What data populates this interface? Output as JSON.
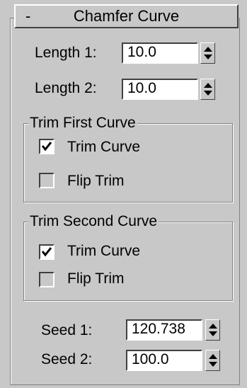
{
  "rollout": {
    "toggle_symbol": "-",
    "title": "Chamfer Curve"
  },
  "length1": {
    "label": "Length 1:",
    "value": "10.0"
  },
  "length2": {
    "label": "Length 2:",
    "value": "10.0"
  },
  "trim_first": {
    "title": "Trim First Curve",
    "trim_curve": {
      "label": "Trim Curve",
      "checked": true
    },
    "flip_trim": {
      "label": "Flip Trim",
      "checked": false
    }
  },
  "trim_second": {
    "title": "Trim Second Curve",
    "trim_curve": {
      "label": "Trim Curve",
      "checked": true
    },
    "flip_trim": {
      "label": "Flip Trim",
      "checked": false
    }
  },
  "seed1": {
    "label": "Seed 1:",
    "value": "120.738"
  },
  "seed2": {
    "label": "Seed 2:",
    "value": "100.0"
  },
  "colors": {
    "panel_bg": "#c8c8c8",
    "field_bg": "#ffffff",
    "shadow": "#404040",
    "highlight": "#ffffff",
    "groove": "#808080"
  }
}
